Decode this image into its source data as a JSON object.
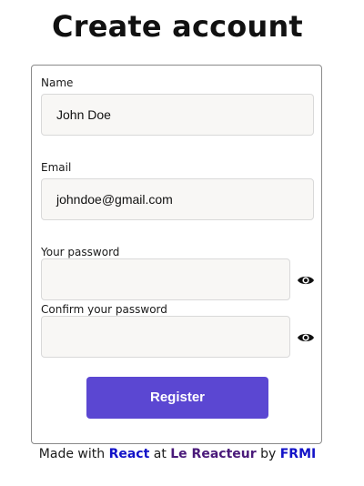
{
  "page": {
    "title": "Create account"
  },
  "form": {
    "name_label": "Name",
    "name_value": "John Doe",
    "email_label": "Email",
    "email_value": "johndoe@gmail.com",
    "password_label": "Your password",
    "password_value": "",
    "confirm_label": "Confirm your password",
    "confirm_value": "",
    "submit_label": "Register"
  },
  "footer": {
    "made_with": "Made with",
    "react": "React",
    "at": "at",
    "le_reacteur": "Le Reacteur",
    "by": "by",
    "frmi": "FRMI"
  },
  "colors": {
    "accent": "#5b47d2",
    "link": "#1212c8",
    "link_alt": "#4a1a7a",
    "field_bg": "#f8f7f5"
  },
  "icons": {
    "show_password": "eye-icon"
  }
}
